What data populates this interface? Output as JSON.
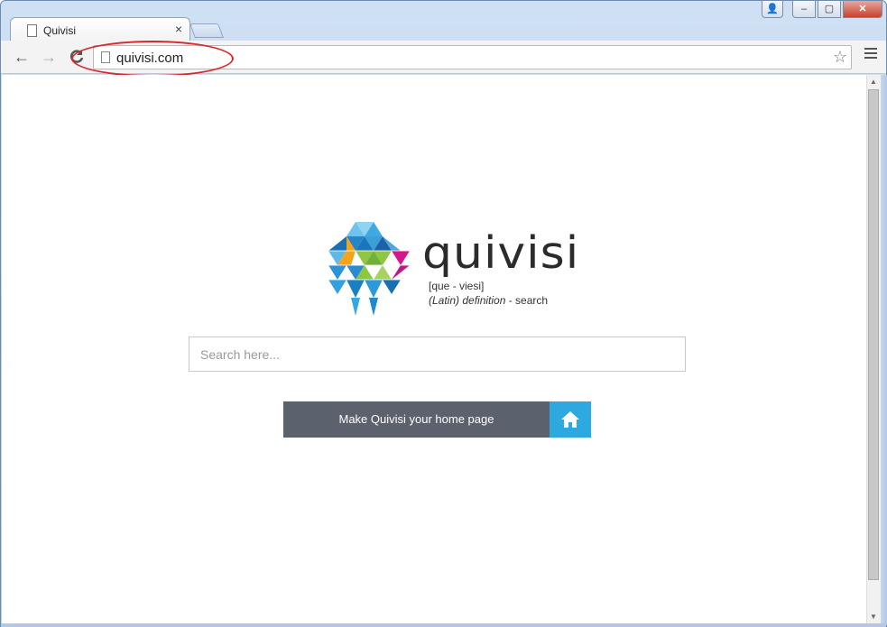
{
  "tab": {
    "title": "Quivisi",
    "close_glyph": "×"
  },
  "window_controls": {
    "user": "👤",
    "minimize": "–",
    "maximize": "▢",
    "close": "✕"
  },
  "toolbar": {
    "back_glyph": "←",
    "forward_glyph": "→",
    "reload_glyph": "↻",
    "url": "quivisi.com",
    "star_glyph": "☆"
  },
  "page": {
    "brand": "quivisi",
    "pronunciation": "[que - viesi]",
    "definition_italic": "(Latin) definition",
    "definition_rest": " - search",
    "search_placeholder": "Search here...",
    "home_button_label": "Make Quivisi your home page"
  },
  "colors": {
    "annotation": "#d8282d",
    "button_dark": "#5b626d",
    "button_accent": "#2ea9e0"
  },
  "icons": {
    "home": "home-icon",
    "star": "star-icon",
    "menu": "hamburger-menu-icon"
  }
}
